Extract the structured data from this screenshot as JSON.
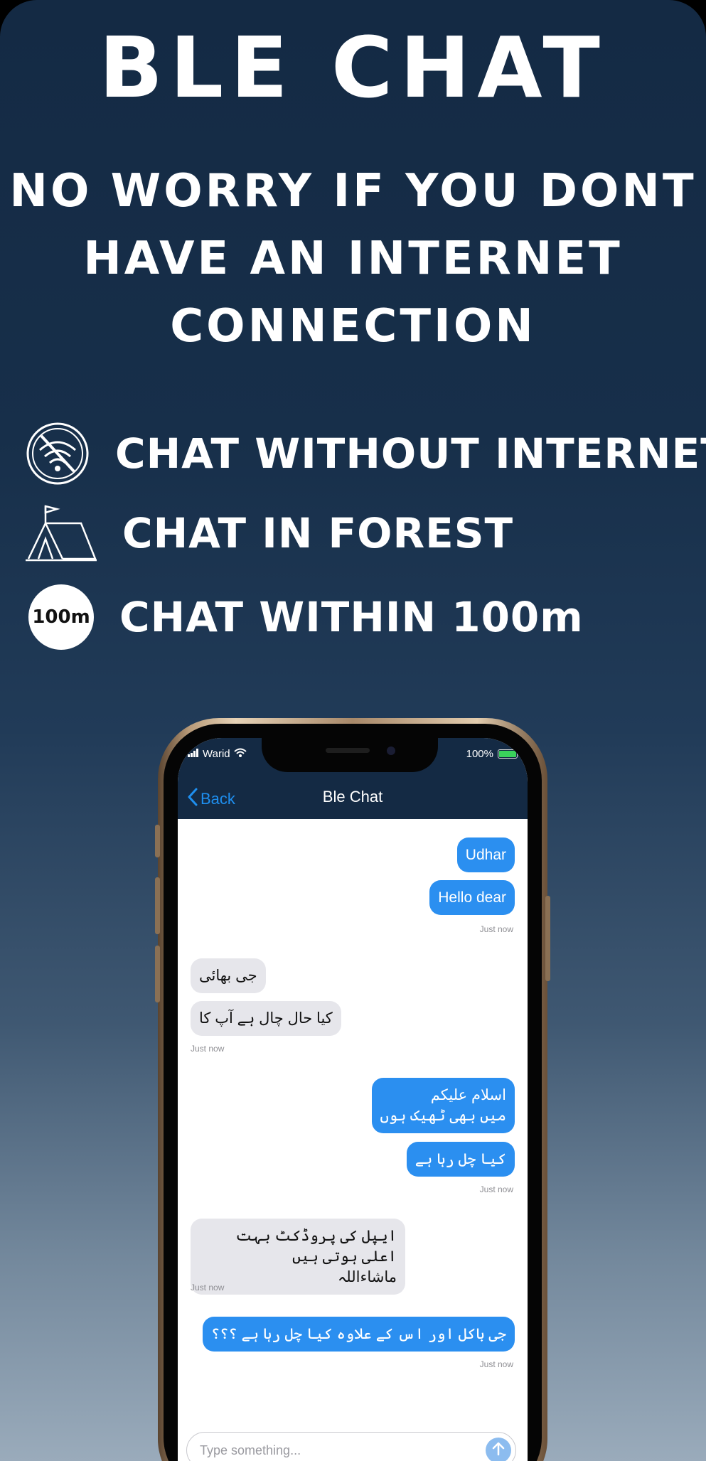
{
  "hero": {
    "title": "BLE CHAT",
    "tagline_line1": "NO WORRY IF YOU DONT",
    "tagline_line2": "HAVE AN INTERNET",
    "tagline_line3": "CONNECTION"
  },
  "features": [
    {
      "icon": "no-wifi-icon",
      "label": "CHAT WITHOUT INTERNET"
    },
    {
      "icon": "tent-icon",
      "label": "CHAT IN FOREST"
    },
    {
      "icon": "range-badge-icon",
      "badge_text": "100m",
      "label": "CHAT WITHIN 100m"
    }
  ],
  "phone": {
    "status": {
      "carrier": "Warid",
      "battery": "100%"
    },
    "nav": {
      "back_label": "Back",
      "title": "Ble Chat"
    },
    "messages": [
      {
        "dir": "out",
        "text": "Udhar"
      },
      {
        "dir": "out",
        "text": "Hello dear",
        "time": "Just now"
      },
      {
        "dir": "in",
        "text": "جی بھائی"
      },
      {
        "dir": "in",
        "text": "کیا حال چال ہے آپ کا",
        "time": "Just now"
      },
      {
        "dir": "out",
        "text": "اسلام علیکم\nمیں بھی ٹھیک ہوں"
      },
      {
        "dir": "out",
        "text": "کیا چل رہا ہے",
        "time": "Just now"
      },
      {
        "dir": "in",
        "text": "ایپل کی پروڈکٹ بہت اعلی ہوتی ہیں\nماشاءاللہ",
        "time": "Just now"
      },
      {
        "dir": "out",
        "text": "جی باکل اور اس کے علاوہ کیا چل رہا ہے ؟؟؟",
        "time": "Just now"
      }
    ],
    "input": {
      "placeholder": "Type something..."
    }
  },
  "colors": {
    "background_top": "#142a44",
    "background_bottom": "#9aabbb",
    "outgoing_bubble": "#2b8ff0",
    "incoming_bubble": "#e6e6eb",
    "accent": "#1e8ff0"
  }
}
